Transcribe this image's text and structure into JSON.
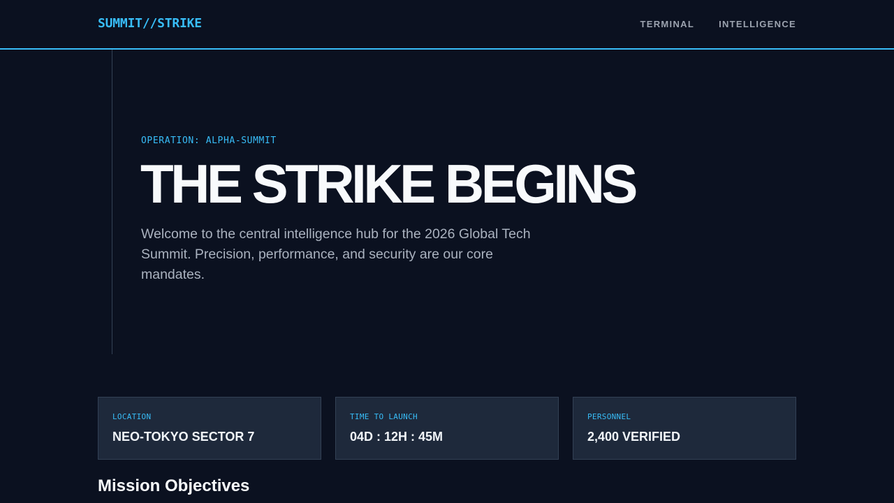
{
  "header": {
    "brand": "SUMMIT//STRIKE",
    "nav": [
      {
        "label": "TERMINAL"
      },
      {
        "label": "INTELLIGENCE"
      }
    ]
  },
  "hero": {
    "eyebrow": "OPERATION: ALPHA-SUMMIT",
    "headline": "THE STRIKE BEGINS",
    "description": "Welcome to the central intelligence hub for the 2026 Global Tech Summit. Precision, performance, and security are our core mandates."
  },
  "stats": [
    {
      "label": "LOCATION",
      "value": "NEO-TOKYO SECTOR 7"
    },
    {
      "label": "TIME TO LAUNCH",
      "value": "04D : 12H : 45M"
    },
    {
      "label": "PERSONNEL",
      "value": "2,400 VERIFIED"
    }
  ],
  "objectives": {
    "title": "Mission Objectives"
  },
  "colors": {
    "background": "#0b1120",
    "accent": "#38bdf8",
    "card": "#1e293b",
    "border": "#334155",
    "text": "#f8fafc",
    "muted": "#aab2bf"
  }
}
